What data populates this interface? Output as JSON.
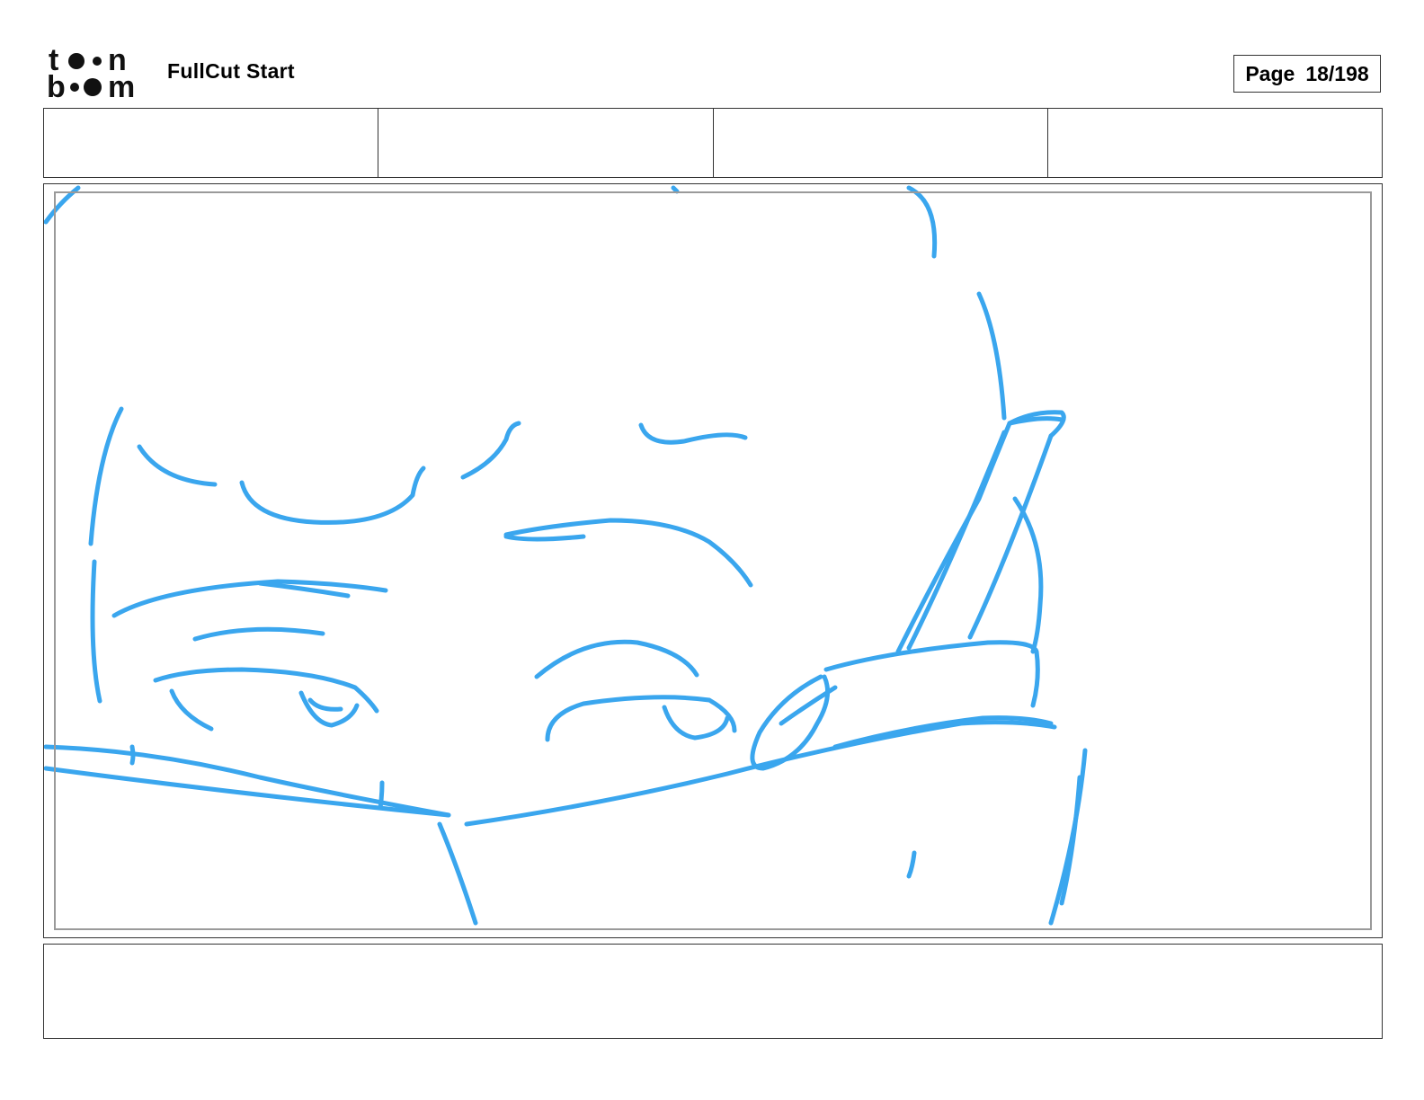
{
  "header": {
    "logo": {
      "icon": "toonboom-logo",
      "line1": "toon",
      "line2": "boom"
    },
    "project_title": "FullCut Start",
    "page_label": "Page",
    "page_value": "18/198"
  },
  "info_row": {
    "cells": [
      "",
      "",
      "",
      ""
    ]
  },
  "panel": {
    "image": "rough-sketch-character-eyes-peeking-over-collar",
    "stroke_color": "#3aa6ee"
  },
  "notes": {
    "text": ""
  }
}
